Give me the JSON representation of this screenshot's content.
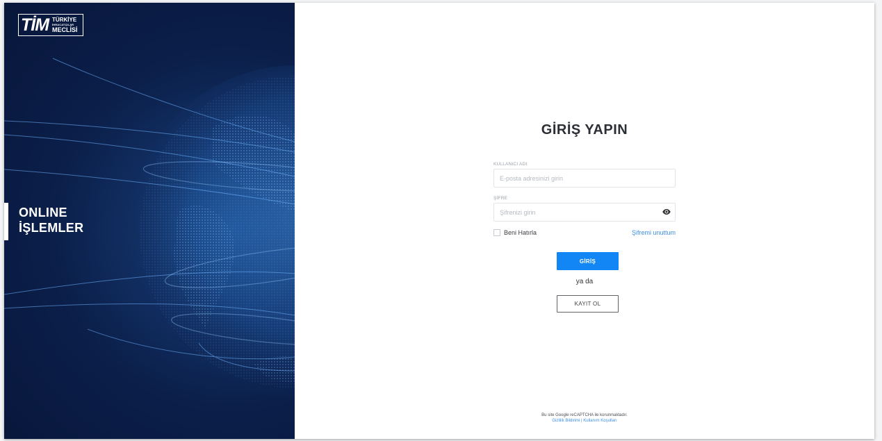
{
  "brand": {
    "logo_main": "TİM",
    "logo_line1": "TÜRKİYE",
    "logo_line2": "İHRACATÇILAR",
    "logo_line3": "MECLİSİ"
  },
  "hero": {
    "line1": "ONLINE",
    "line2": "İŞLEMLER"
  },
  "login": {
    "title": "GİRİŞ YAPIN",
    "username_label": "KULLANICI ADI",
    "username_placeholder": "E-posta adresinizi girin",
    "password_label": "ŞİFRE",
    "password_placeholder": "Şifrenizi girin",
    "remember_label": "Beni Hatırla",
    "forgot_label": "Şifremi unuttum",
    "submit_label": "GİRİŞ",
    "or_label": "ya da",
    "register_label": "KAYIT OL"
  },
  "footer": {
    "recaptcha_text": "Bu site Google reCAPTCHA ile korunmaktadır.",
    "privacy_link": "Gizlilik Bildirimi",
    "separator": "|",
    "terms_link": "Kullanım Koşulları"
  },
  "colors": {
    "primary": "#1386f5",
    "panel_dark": "#0b1f4a",
    "link": "#3d8fe6"
  },
  "icons": {
    "password_toggle": "eye-icon"
  }
}
